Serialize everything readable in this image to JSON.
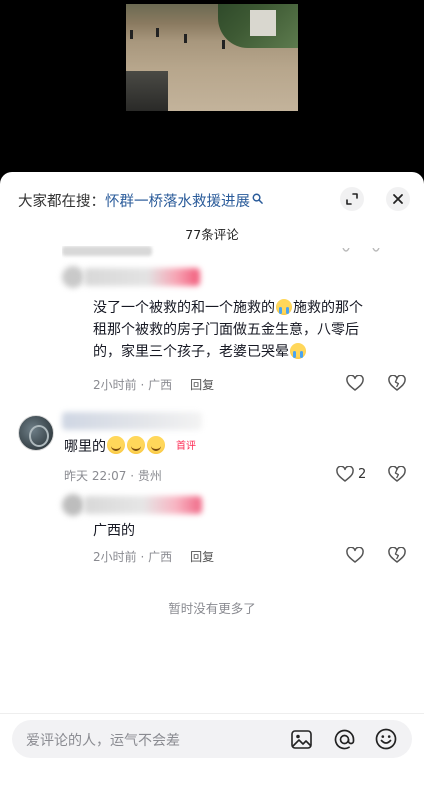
{
  "search": {
    "prefix": "大家都在搜：",
    "topic": "怀群一桥落水救援进展"
  },
  "comments_header": {
    "count_label": "77条评论"
  },
  "comments": [
    {
      "text_part1": "没了一个被救的和一个施救的",
      "text_part2": "施救的那个",
      "text_line2": "租那个被救的房子门面做五金生意，八零后",
      "text_line3a": "的，家里三个孩子，老婆已哭晕",
      "meta": "2小时前 · 广西",
      "reply_label": "回复"
    },
    {
      "text": "哪里的",
      "badge": "首评",
      "meta": "昨天 22:07 · 贵州",
      "like_count": "2"
    },
    {
      "text": "广西的",
      "meta": "2小时前 · 广西",
      "reply_label": "回复"
    }
  ],
  "footer": {
    "no_more": "暂时没有更多了"
  },
  "input": {
    "placeholder": "爱评论的人，运气不会差"
  },
  "colors": {
    "accent_red": "#fe2c55",
    "link_blue": "#2a5b9a"
  }
}
